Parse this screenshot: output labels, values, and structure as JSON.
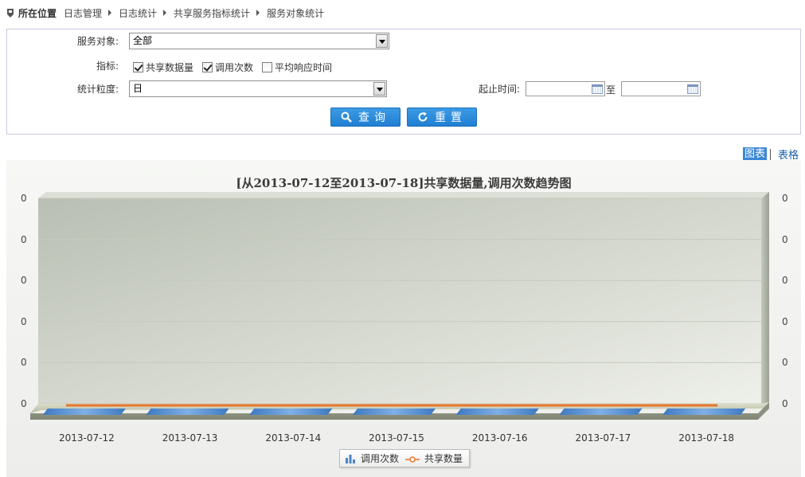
{
  "breadcrumb": {
    "head": "所在位置",
    "items": [
      "日志管理",
      "日志统计",
      "共享服务指标统计",
      "服务对象统计"
    ]
  },
  "form": {
    "service_label": "服务对象:",
    "service_value": "全部",
    "indicator_label": "指标:",
    "indicators": [
      {
        "label": "共享数据量",
        "checked": true
      },
      {
        "label": "调用次数",
        "checked": true
      },
      {
        "label": "平均响应时间",
        "checked": false
      }
    ],
    "granularity_label": "统计粒度:",
    "granularity_value": "日",
    "time_label": "起止时间:",
    "start_value": "",
    "to_label": "至",
    "end_value": "",
    "query_button": "查询",
    "reset_button": "重置"
  },
  "view_tabs": {
    "chart": "图表",
    "table": "表格"
  },
  "colors": {
    "accent": "#2b8ad9",
    "bar_series": "#4a86c8",
    "line_series": "#e8752c",
    "panel_border": "#c9cbe0"
  },
  "chart_data": {
    "type": "bar",
    "title": "[从2013-07-12至2013-07-18]共享数据量,调用次数趋势图",
    "categories": [
      "2013-07-12",
      "2013-07-13",
      "2013-07-14",
      "2013-07-15",
      "2013-07-16",
      "2013-07-17",
      "2013-07-18"
    ],
    "series": [
      {
        "name": "调用次数",
        "type": "bar",
        "axis": "left",
        "values": [
          0,
          0,
          0,
          0,
          0,
          0,
          0
        ]
      },
      {
        "name": "共享数量",
        "type": "line",
        "axis": "right",
        "values": [
          0,
          0,
          0,
          0,
          0,
          0,
          0
        ]
      }
    ],
    "y_ticks_left": [
      "0",
      "0",
      "0",
      "0",
      "0",
      "0"
    ],
    "y_ticks_right": [
      "0",
      "0",
      "0",
      "0",
      "0",
      "0"
    ],
    "legend": "bottom-center",
    "grid": true
  }
}
